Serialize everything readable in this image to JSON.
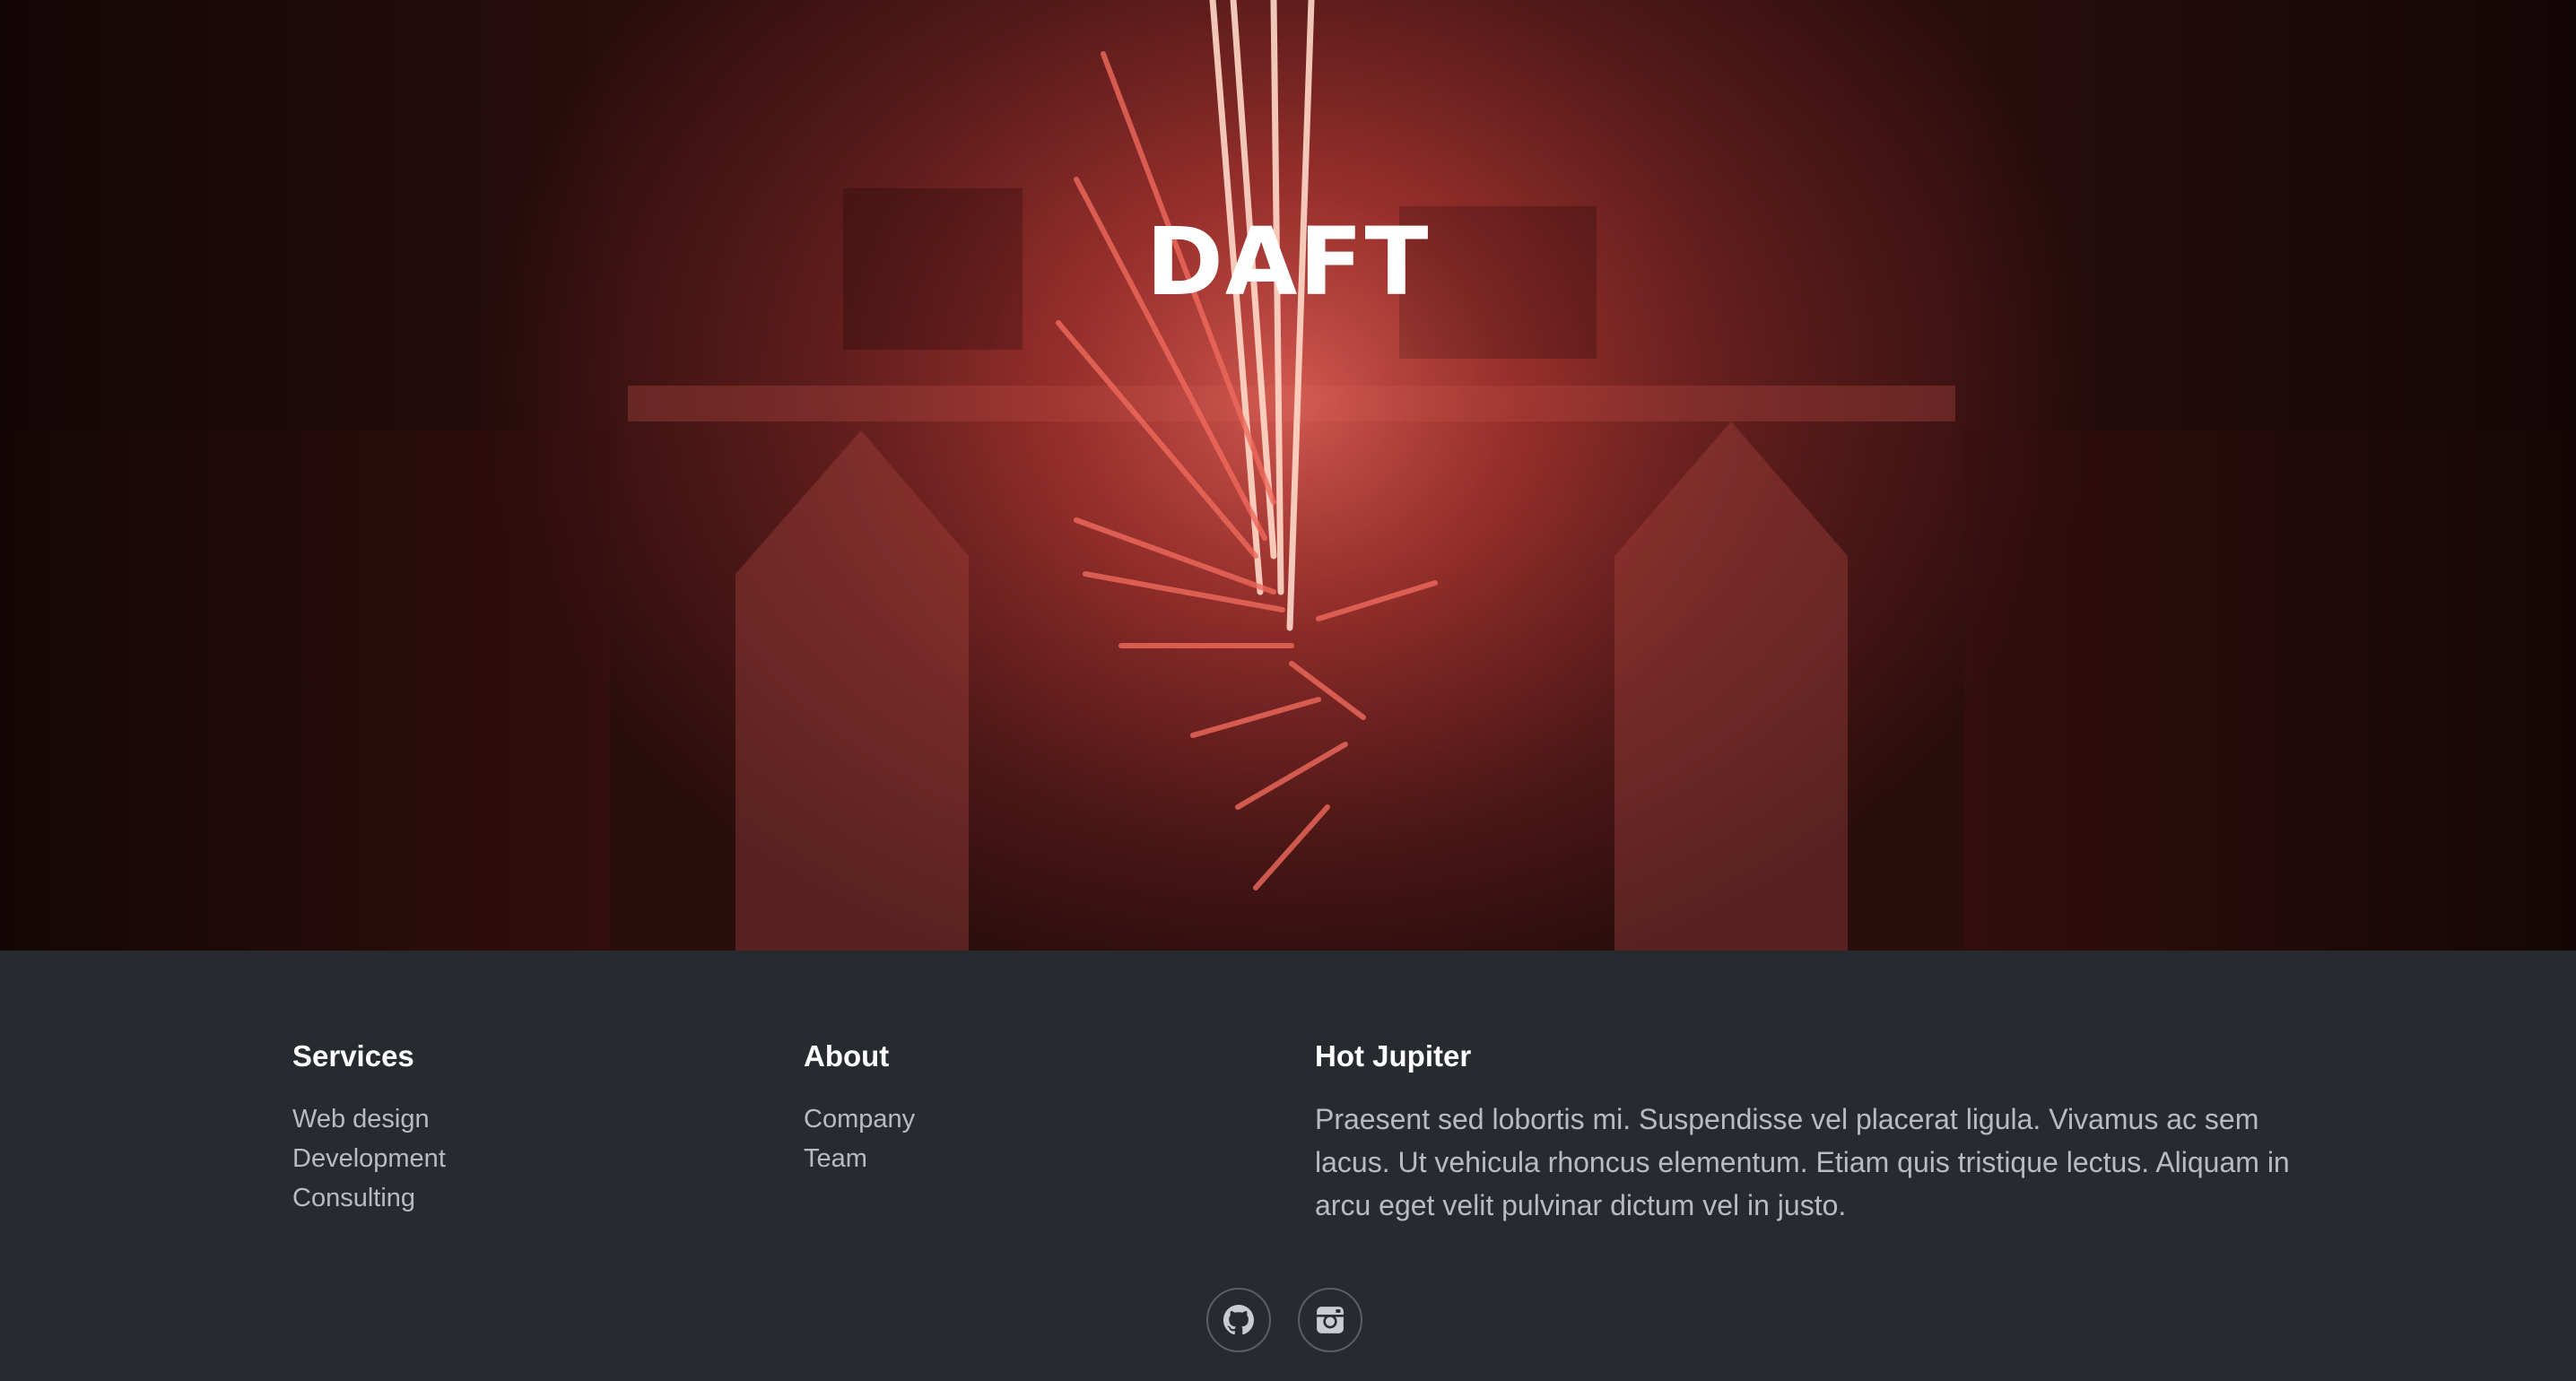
{
  "hero": {
    "title": "DAFT"
  },
  "footer": {
    "services": {
      "heading": "Services",
      "links": [
        "Web design",
        "Development",
        "Consulting"
      ]
    },
    "about": {
      "heading": "About",
      "links": [
        "Company",
        "Team"
      ]
    },
    "hot_jupiter": {
      "heading": "Hot Jupiter",
      "text": "Praesent sed lobortis mi. Suspendisse vel placerat ligula. Vivamus ac sem lacus. Ut vehicula rhoncus elementum. Etiam quis tristique lectus. Aliquam in arcu eget velit pulvinar dictum vel in justo."
    },
    "social": [
      {
        "icon": "github-icon"
      },
      {
        "icon": "instagram-icon"
      }
    ]
  },
  "colors": {
    "footer_bg": "#272b30",
    "hero_red": "#9a3230",
    "heading": "#ffffff",
    "text": "#b7bcc2"
  }
}
